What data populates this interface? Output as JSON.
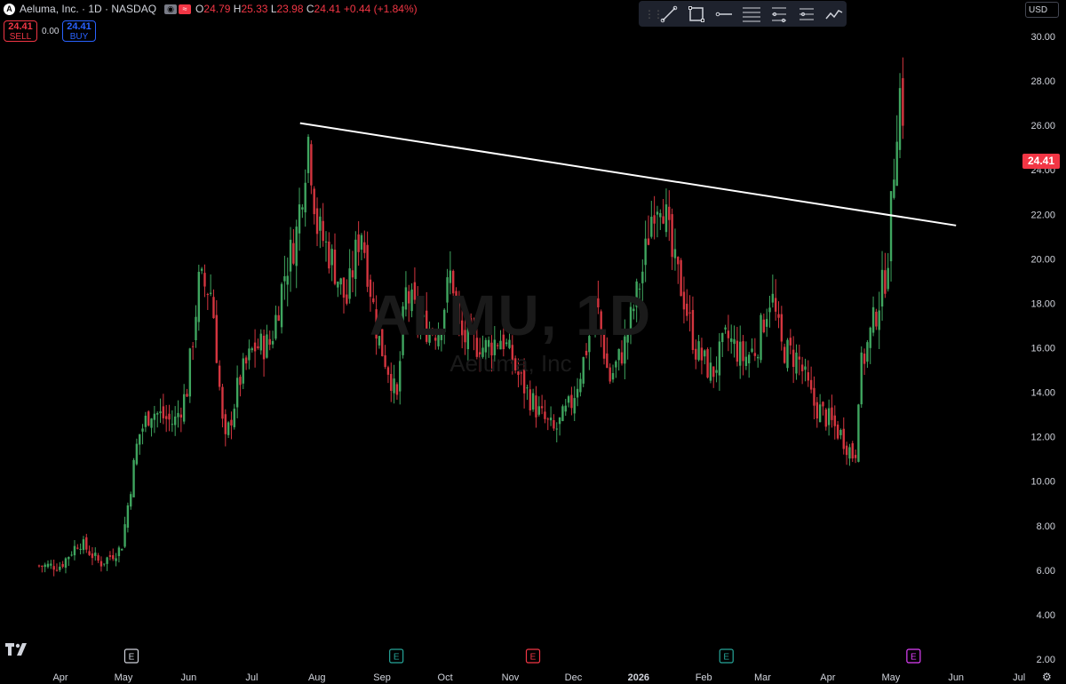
{
  "header": {
    "logo_letter": "A",
    "title": "Aeluma, Inc. · 1D · NASDAQ",
    "ohlc": {
      "o_label": "O",
      "o": "24.79",
      "h_label": "H",
      "h": "25.33",
      "l_label": "L",
      "l": "23.98",
      "c_label": "C",
      "c": "24.41",
      "change": "+0.44 (+1.84%)"
    }
  },
  "trade": {
    "sell_price": "24.41",
    "sell_label": "SELL",
    "spread": "0.00",
    "buy_price": "24.41",
    "buy_label": "BUY"
  },
  "toolbar": {
    "tools": [
      "trend-line-icon",
      "rectangle-icon",
      "horizontal-ray-icon",
      "parallel-channel-icon",
      "fib-retracement-icon",
      "long-position-icon",
      "forecast-icon"
    ]
  },
  "currency": "USD",
  "last_price_tag": "24.41",
  "watermark": {
    "symbol": "ALMU, 1D",
    "name": "Aeluma, Inc"
  },
  "colors": {
    "up": "#26a69a",
    "down": "#f23645",
    "up_candle": "#3fa55f",
    "down_candle": "#d4353f",
    "background": "#000000",
    "earnings_up": "#26a69a",
    "earnings_down": "#f23645",
    "dividend": "#e040fb"
  },
  "events": [
    {
      "type": "earnings",
      "label": "E",
      "near": "May",
      "color": "neutral"
    },
    {
      "type": "earnings",
      "label": "E",
      "near": "Sep",
      "color": "up"
    },
    {
      "type": "earnings",
      "label": "E",
      "near": "Nov",
      "color": "down"
    },
    {
      "type": "earnings",
      "label": "E",
      "near": "Feb",
      "color": "up"
    },
    {
      "type": "split_and_earnings",
      "label": "E",
      "near": "May",
      "color": "purple"
    }
  ],
  "chart_data": {
    "type": "candlestick",
    "title": "Aeluma, Inc. · 1D · NASDAQ",
    "y_ticks": [
      2,
      4,
      6,
      8,
      10,
      12,
      14,
      16,
      18,
      20,
      22,
      24,
      26,
      28,
      30
    ],
    "y_tick_labels": [
      "2.00",
      "4.00",
      "6.00",
      "8.00",
      "10.00",
      "12.00",
      "14.00",
      "16.00",
      "18.00",
      "20.00",
      "22.00",
      "24.00",
      "26.00",
      "28.00",
      "30.00"
    ],
    "x_labels": [
      "Apr",
      "May",
      "Jun",
      "Jul",
      "Aug",
      "Sep",
      "Oct",
      "Nov",
      "Dec",
      "2026",
      "Feb",
      "Mar",
      "Apr",
      "May",
      "Jun",
      "Jul"
    ],
    "ylim": [
      2,
      30.5
    ],
    "last_price": 24.41,
    "close_path": [
      [
        "2025-04-01",
        6.2
      ],
      [
        "2025-04-10",
        7.3
      ],
      [
        "2025-04-20",
        6.3
      ],
      [
        "2025-04-30",
        7.0
      ],
      [
        "2025-05-08",
        12.0
      ],
      [
        "2025-05-14",
        13.2
      ],
      [
        "2025-05-25",
        12.6
      ],
      [
        "2025-05-31",
        14.0
      ],
      [
        "2025-06-06",
        19.0
      ],
      [
        "2025-06-12",
        18.5
      ],
      [
        "2025-06-18",
        11.5
      ],
      [
        "2025-06-25",
        14.5
      ],
      [
        "2025-07-02",
        16.0
      ],
      [
        "2025-07-10",
        16.2
      ],
      [
        "2025-07-17",
        19.5
      ],
      [
        "2025-07-22",
        21.0
      ],
      [
        "2025-07-28",
        25.5
      ],
      [
        "2025-08-01",
        21.5
      ],
      [
        "2025-08-08",
        20.0
      ],
      [
        "2025-08-15",
        18.0
      ],
      [
        "2025-08-22",
        21.5
      ],
      [
        "2025-08-30",
        16.5
      ],
      [
        "2025-09-05",
        14.8
      ],
      [
        "2025-09-08",
        13.5
      ],
      [
        "2025-09-12",
        18.5
      ],
      [
        "2025-09-20",
        17.0
      ],
      [
        "2025-09-28",
        16.8
      ],
      [
        "2025-10-04",
        19.5
      ],
      [
        "2025-10-08",
        16.5
      ],
      [
        "2025-10-20",
        16.0
      ],
      [
        "2025-10-28",
        16.5
      ],
      [
        "2025-11-06",
        14.5
      ],
      [
        "2025-11-15",
        13.0
      ],
      [
        "2025-11-22",
        12.2
      ],
      [
        "2025-11-30",
        13.5
      ],
      [
        "2025-12-06",
        15.5
      ],
      [
        "2025-12-12",
        18.0
      ],
      [
        "2025-12-18",
        14.5
      ],
      [
        "2025-12-25",
        16.0
      ],
      [
        "2026-01-03",
        19.5
      ],
      [
        "2026-01-08",
        22.5
      ],
      [
        "2026-01-12",
        23.0
      ],
      [
        "2026-01-17",
        20.0
      ],
      [
        "2026-01-22",
        18.5
      ],
      [
        "2026-01-28",
        16.0
      ],
      [
        "2026-02-05",
        14.8
      ],
      [
        "2026-02-12",
        16.5
      ],
      [
        "2026-02-20",
        15.5
      ],
      [
        "2026-02-26",
        16.0
      ],
      [
        "2026-03-05",
        18.5
      ],
      [
        "2026-03-10",
        16.0
      ],
      [
        "2026-03-18",
        15.5
      ],
      [
        "2026-03-25",
        13.5
      ],
      [
        "2026-04-01",
        12.8
      ],
      [
        "2026-04-08",
        12.0
      ],
      [
        "2026-04-14",
        11.0
      ],
      [
        "2026-04-16",
        14.8
      ],
      [
        "2026-04-21",
        16.5
      ],
      [
        "2026-04-25",
        18.0
      ],
      [
        "2026-04-29",
        19.5
      ],
      [
        "2026-05-01",
        22.0
      ],
      [
        "2026-05-04",
        26.5
      ],
      [
        "2026-05-06",
        28.0
      ],
      [
        "2026-05-08",
        24.41
      ]
    ],
    "trend_line": {
      "from": [
        "2025-07-24",
        26.1
      ],
      "to": [
        "2026-06-01",
        21.5
      ]
    }
  }
}
